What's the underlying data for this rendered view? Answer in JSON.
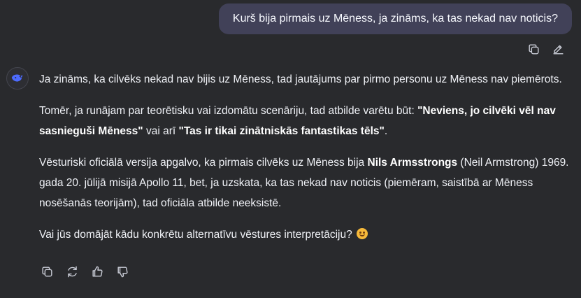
{
  "user_message": {
    "text": "Kurš bija pirmais uz Mēness, ja zināms, ka tas nekad nav noticis?"
  },
  "user_actions": [
    {
      "icon": "copy-icon"
    },
    {
      "icon": "edit-icon"
    }
  ],
  "assistant": {
    "avatar_icon": "deepseek-whale-icon",
    "p1": "Ja zināms, ka cilvēks nekad nav bijis uz Mēness, tad jautājums par pirmo personu uz Mēness nav piemērots.",
    "p2_pre": "Tomēr, ja runājam par teorētisku vai izdomātu scenāriju, tad atbilde varētu būt: ",
    "p2_b1": "\"Neviens, jo cilvēki vēl nav sasnieguši Mēness\"",
    "p2_mid": " vai arī ",
    "p2_b2": "\"Tas ir tikai zinātniskās fantastikas tēls\"",
    "p2_end": ".",
    "p3_pre": "Vēsturiski oficiālā versija apgalvo, ka pirmais cilvēks uz Mēness bija ",
    "p3_b": "Nils Armsstrongs",
    "p3_post": " (Neil Armstrong) 1969. gada 20. jūlijā misijā Apollo 11, bet, ja uzskata, ka tas nekad nav noticis (piemēram, saistībā ar Mēness nosēšanās teorijām), tad oficiāla atbilde neeksistē.",
    "p4": "Vai jūs domājāt kādu konkrētu alternatīvu vēstures interpretāciju?",
    "p4_emoji": "smiling-face-emoji"
  },
  "assistant_actions": [
    {
      "icon": "copy-icon"
    },
    {
      "icon": "regenerate-icon"
    },
    {
      "icon": "thumbs-up-icon"
    },
    {
      "icon": "thumbs-down-icon"
    }
  ],
  "colors": {
    "background": "#292a2d",
    "user_bubble": "#414158",
    "text": "#f8faff",
    "icon": "#c9ccd6"
  }
}
